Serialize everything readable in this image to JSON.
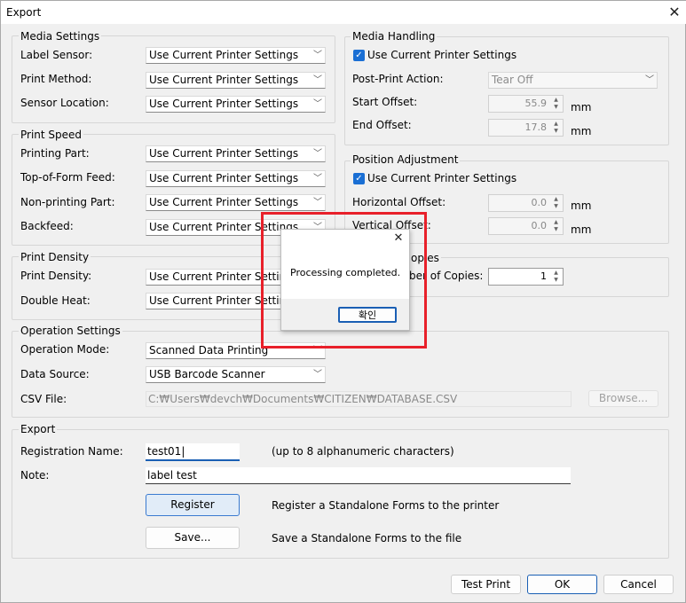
{
  "window": {
    "title": "Export"
  },
  "media_settings": {
    "title": "Media Settings",
    "label_sensor": {
      "label": "Label Sensor:",
      "value": "Use Current Printer Settings"
    },
    "print_method": {
      "label": "Print Method:",
      "value": "Use Current Printer Settings"
    },
    "sensor_location": {
      "label": "Sensor Location:",
      "value": "Use Current Printer Settings"
    }
  },
  "print_speed": {
    "title": "Print Speed",
    "printing_part": {
      "label": "Printing Part:",
      "value": "Use Current Printer Settings"
    },
    "top_of_form_feed": {
      "label": "Top-of-Form Feed:",
      "value": "Use Current Printer Settings"
    },
    "non_printing_part": {
      "label": "Non-printing Part:",
      "value": "Use Current Printer Settings"
    },
    "backfeed": {
      "label": "Backfeed:",
      "value": "Use Current Printer Settings"
    }
  },
  "print_density": {
    "title": "Print Density",
    "density": {
      "label": "Print Density:",
      "value": "Use Current Printer Settings"
    },
    "double_heat": {
      "label": "Double Heat:",
      "value": "Use Current Printer Settings"
    }
  },
  "operation_settings": {
    "title": "Operation Settings",
    "mode": {
      "label": "Operation Mode:",
      "value": "Scanned Data Printing"
    },
    "source": {
      "label": "Data Source:",
      "value": "USB Barcode Scanner"
    },
    "csv": {
      "label": "CSV File:",
      "value": "C:₩Users₩devch₩Documents₩CITIZEN₩DATABASE.CSV",
      "browse": "Browse..."
    }
  },
  "media_handling": {
    "title": "Media Handling",
    "use_current": "Use Current Printer Settings",
    "post_print": {
      "label": "Post-Print Action:",
      "value": "Tear Off"
    },
    "start_offset": {
      "label": "Start Offset:",
      "value": "55.9",
      "unit": "mm"
    },
    "end_offset": {
      "label": "End Offset:",
      "value": "17.8",
      "unit": "mm"
    }
  },
  "position_adjustment": {
    "title": "Position Adjustment",
    "use_current": "Use Current Printer Settings",
    "horizontal": {
      "label": "Horizontal Offset:",
      "value": "0.0",
      "unit": "mm"
    },
    "vertical": {
      "label": "Vertical Offset:",
      "value": "0.0",
      "unit": "mm"
    }
  },
  "copies": {
    "title_fragment": "opies",
    "label_fragment": "ber of Copies:",
    "value": "1"
  },
  "export": {
    "title": "Export",
    "reg_name": {
      "label": "Registration Name:",
      "value": "test01|",
      "hint": "(up to 8 alphanumeric characters)"
    },
    "note": {
      "label": "Note:",
      "value": "label test"
    },
    "register": {
      "button": "Register",
      "desc": "Register a Standalone Forms to the printer"
    },
    "save": {
      "button": "Save...",
      "desc": "Save a Standalone Forms to the file"
    }
  },
  "footer": {
    "test_print": "Test Print",
    "ok": "OK",
    "cancel": "Cancel"
  },
  "dialog": {
    "message": "Processing completed.",
    "confirm": "확인"
  },
  "colors": {
    "highlight": "#e8202a",
    "accent": "#1a6fd4"
  }
}
